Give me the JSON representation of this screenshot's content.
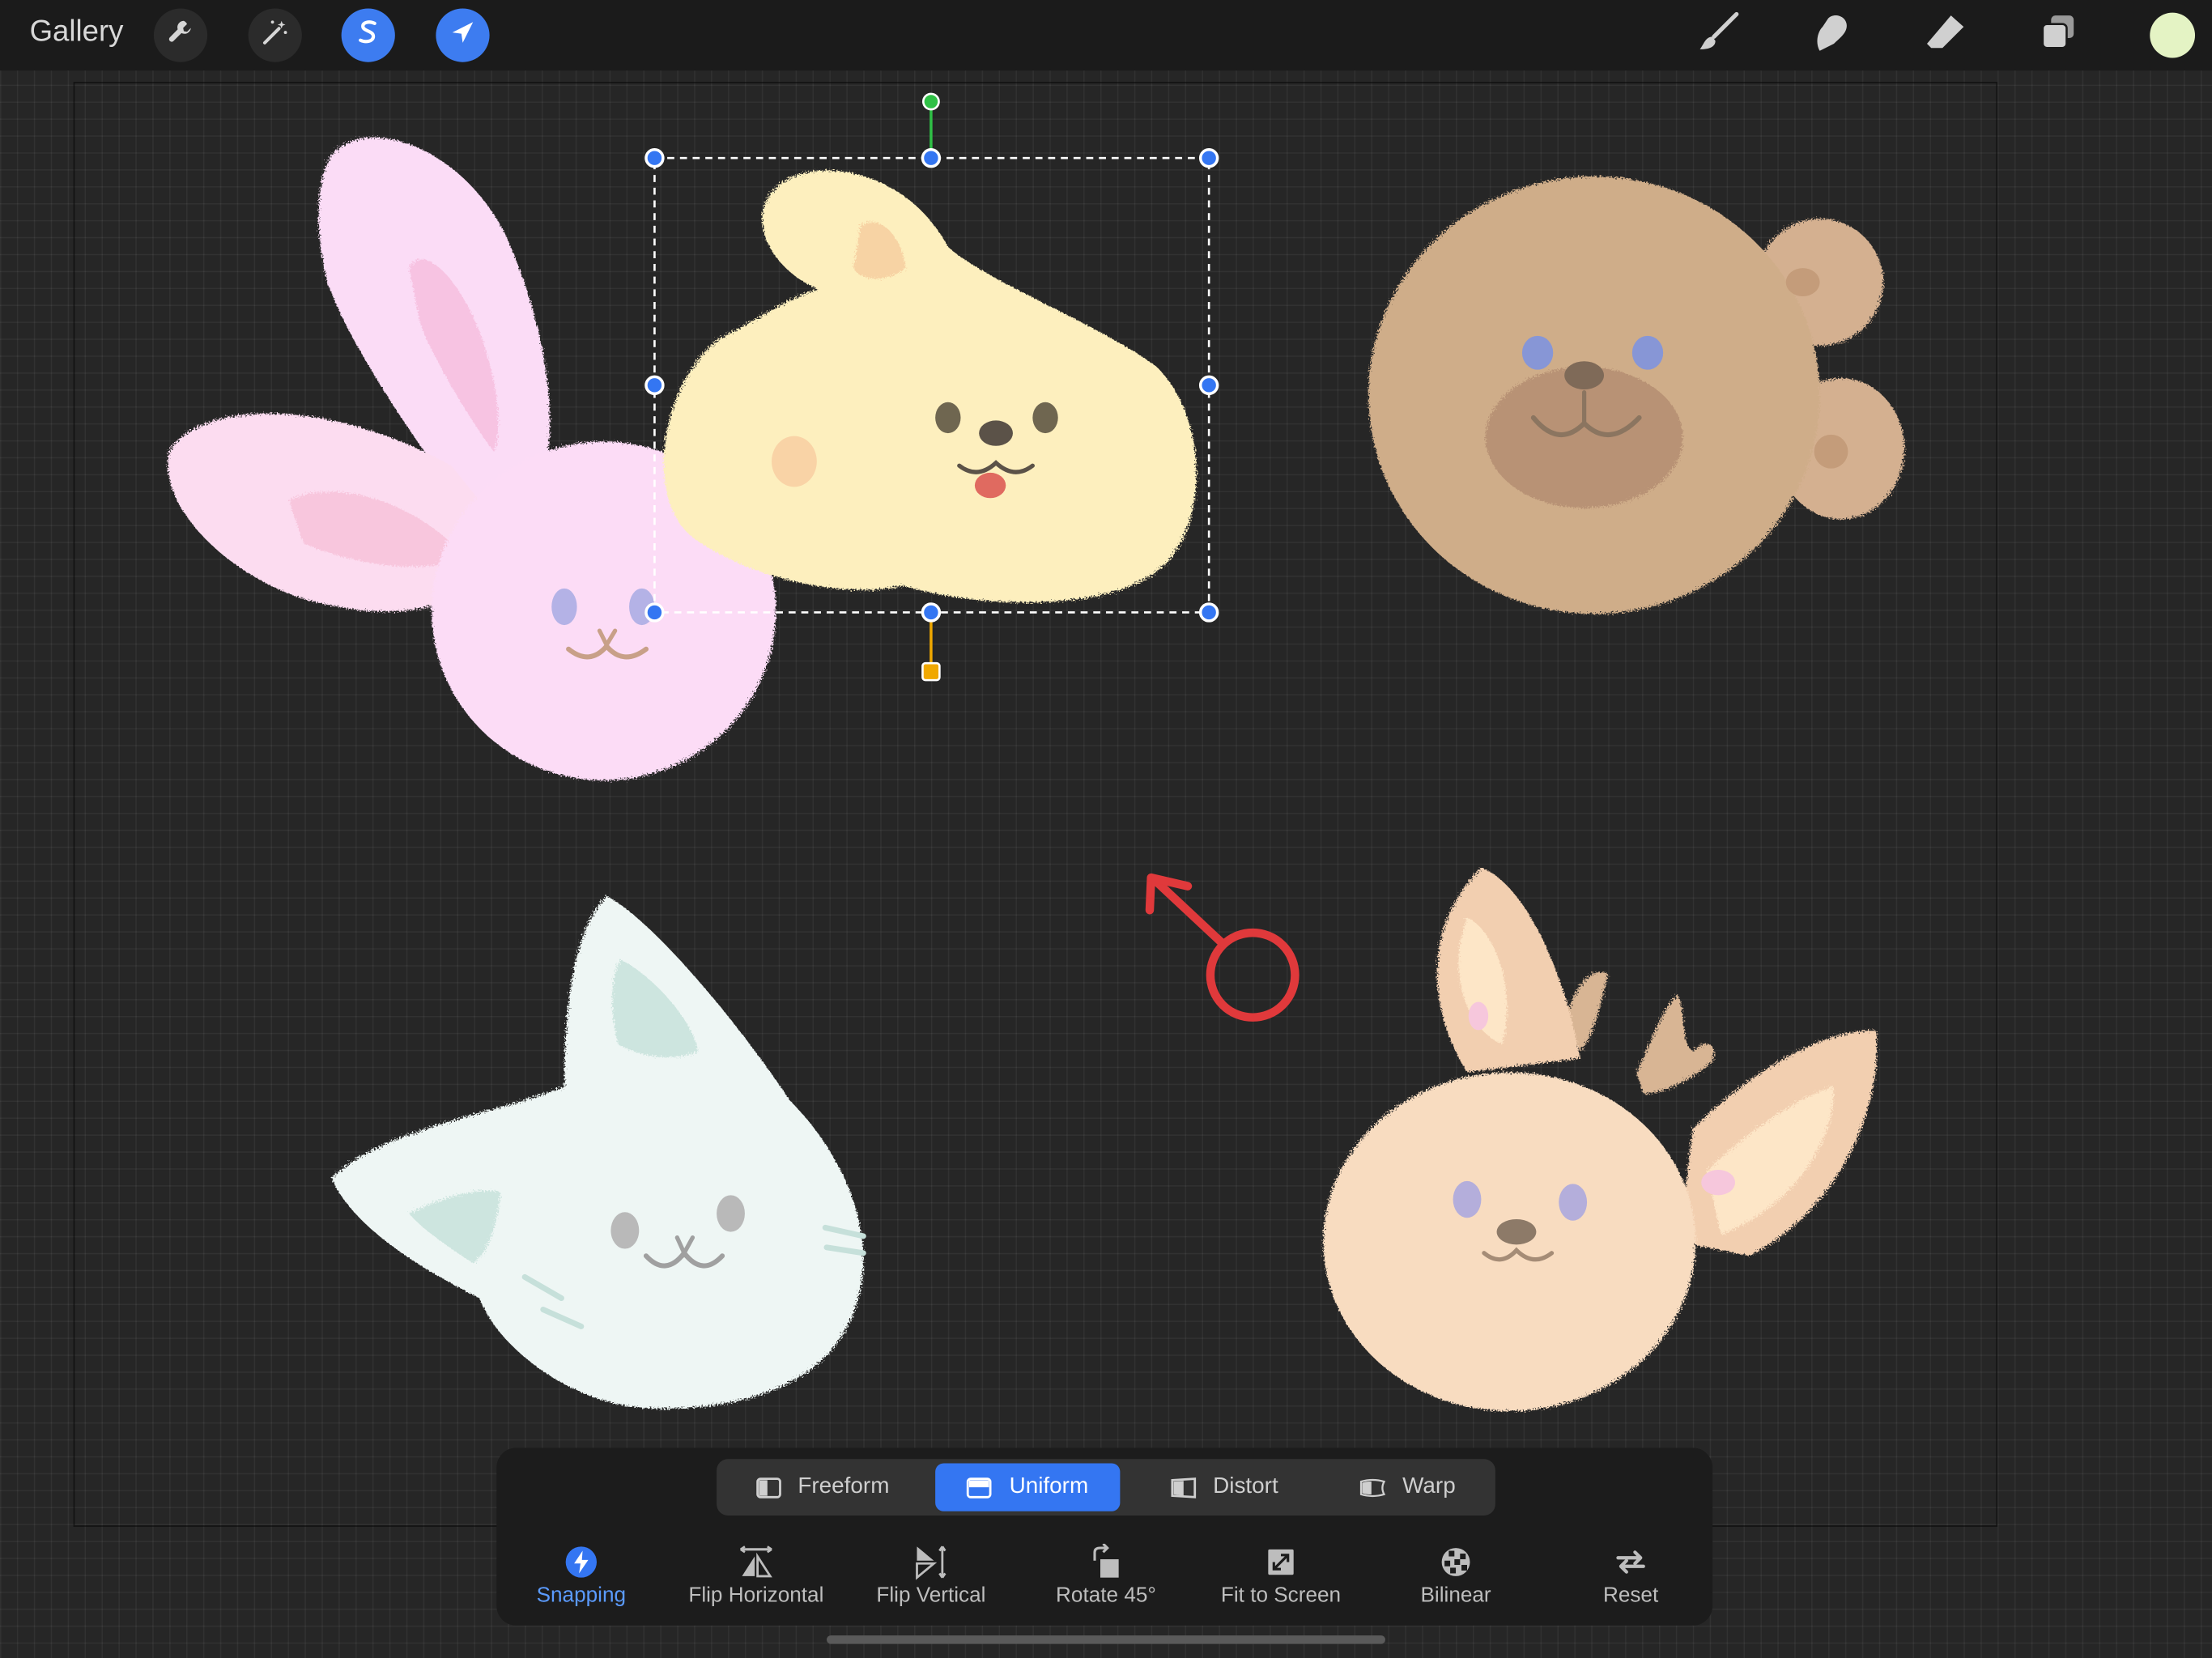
{
  "topbar": {
    "gallery_label": "Gallery",
    "left_icons": [
      "wrench-icon",
      "magic-wand-icon",
      "selection-s-icon",
      "transform-arrow-icon"
    ],
    "right_icons": [
      "brush-icon",
      "smudge-icon",
      "eraser-icon",
      "layers-icon"
    ],
    "current_color": "#e4f3c4"
  },
  "transform_modes": [
    {
      "label": "Freeform",
      "active": false
    },
    {
      "label": "Uniform",
      "active": true
    },
    {
      "label": "Distort",
      "active": false
    },
    {
      "label": "Warp",
      "active": false
    }
  ],
  "tools": [
    {
      "label": "Snapping",
      "icon": "lightning-icon",
      "active": true
    },
    {
      "label": "Flip Horizontal",
      "icon": "flip-horizontal-icon",
      "active": false
    },
    {
      "label": "Flip Vertical",
      "icon": "flip-vertical-icon",
      "active": false
    },
    {
      "label": "Rotate 45°",
      "icon": "rotate-45-icon",
      "active": false
    },
    {
      "label": "Fit to Screen",
      "icon": "fit-to-screen-icon",
      "active": false
    },
    {
      "label": "Bilinear",
      "icon": "bilinear-icon",
      "active": false
    },
    {
      "label": "Reset",
      "icon": "reset-icon",
      "active": false
    }
  ],
  "colors": {
    "accent": "#3476f2",
    "rotation_handle": "#2fc046",
    "pivot_handle": "#f0a800",
    "annotation": "#e0393b"
  },
  "canvas_objects": [
    "bunny",
    "dog",
    "bear",
    "cat",
    "deer"
  ]
}
